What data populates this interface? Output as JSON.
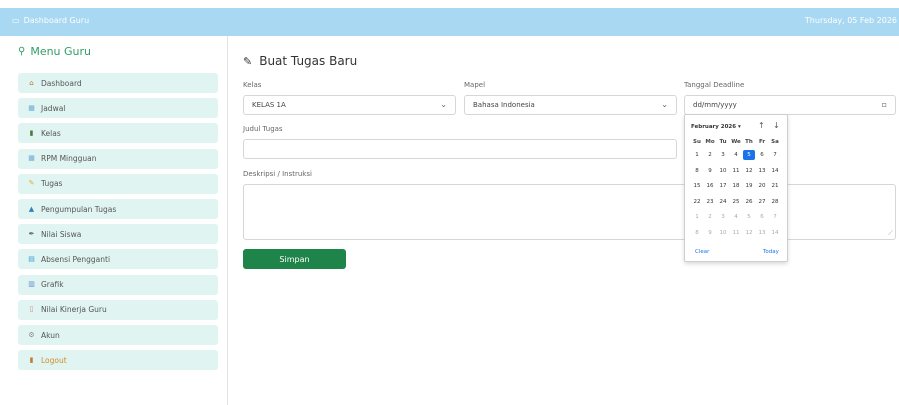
{
  "topbar": {
    "title": "Dashboard Guru",
    "date": "Thursday, 05 Feb 2026"
  },
  "sidebar": {
    "title": "Menu Guru",
    "items": [
      {
        "label": "Dashboard",
        "icon": "home-icon",
        "color": "#c0703a"
      },
      {
        "label": "Jadwal",
        "icon": "calendar-icon",
        "color": "#6aa6d6"
      },
      {
        "label": "Kelas",
        "icon": "books-icon",
        "color": "#4a7a3a"
      },
      {
        "label": "RPM Mingguan",
        "icon": "calendar-icon",
        "color": "#6aa6d6"
      },
      {
        "label": "Tugas",
        "icon": "pencil-icon",
        "color": "#e0a83a"
      },
      {
        "label": "Pengumpulan Tugas",
        "icon": "upload-icon",
        "color": "#3a7fb6"
      },
      {
        "label": "Nilai Siswa",
        "icon": "pen-icon",
        "color": "#555555"
      },
      {
        "label": "Absensi Pengganti",
        "icon": "clipboard-icon",
        "color": "#3a9ad6"
      },
      {
        "label": "Grafik",
        "icon": "chart-icon",
        "color": "#5a8ad0"
      },
      {
        "label": "Nilai Kinerja Guru",
        "icon": "document-icon",
        "color": "#d08a6a"
      },
      {
        "label": "Akun",
        "icon": "gear-icon",
        "color": "#888888"
      },
      {
        "label": "Logout",
        "icon": "door-icon",
        "color": "#c07a3a"
      }
    ]
  },
  "form": {
    "title": "Buat Tugas Baru",
    "kelas_label": "Kelas",
    "kelas_value": "KELAS 1A",
    "mapel_label": "Mapel",
    "mapel_value": "Bahasa Indonesia",
    "deadline_label": "Tanggal Deadline",
    "deadline_value": "dd/mm/yyyy",
    "judul_label": "Judul Tugas",
    "judul_value": "",
    "deskripsi_label": "Deskripsi / Instruksi",
    "deskripsi_value": "",
    "submit_label": "Simpan"
  },
  "calendar": {
    "month_label": "February 2026 ▾",
    "weekdays": [
      "Su",
      "Mo",
      "Tu",
      "We",
      "Th",
      "Fr",
      "Sa"
    ],
    "weeks": [
      [
        "1",
        "2",
        "3",
        "4",
        "5",
        "6",
        "7"
      ],
      [
        "8",
        "9",
        "10",
        "11",
        "12",
        "13",
        "14"
      ],
      [
        "15",
        "16",
        "17",
        "18",
        "19",
        "20",
        "21"
      ],
      [
        "22",
        "23",
        "24",
        "25",
        "26",
        "27",
        "28"
      ],
      [
        "1",
        "2",
        "3",
        "4",
        "5",
        "6",
        "7"
      ],
      [
        "8",
        "9",
        "10",
        "11",
        "12",
        "13",
        "14"
      ]
    ],
    "selected_day": "5",
    "clear_label": "Clear",
    "today_label": "Today"
  }
}
